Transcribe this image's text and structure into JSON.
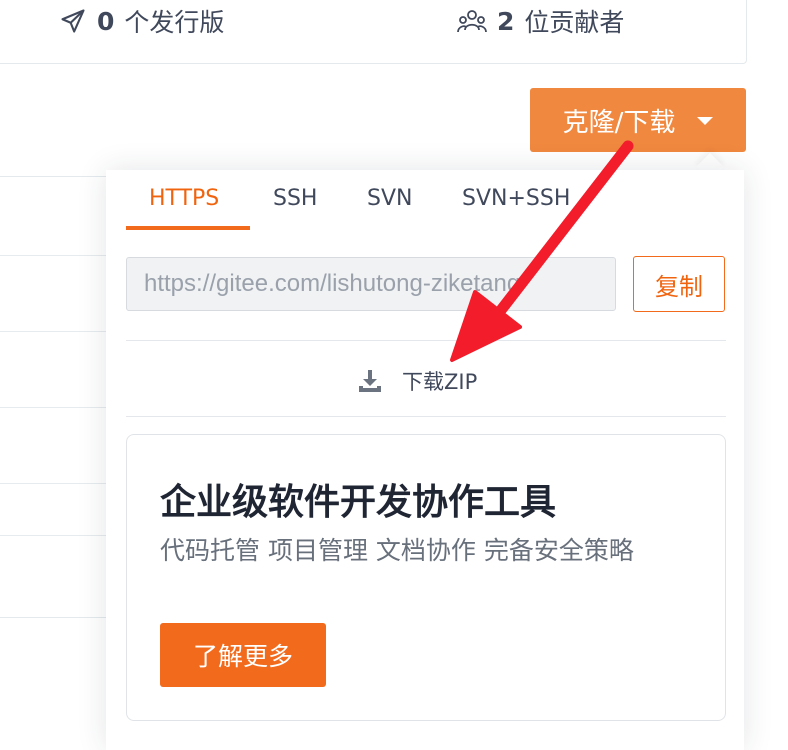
{
  "stats": {
    "releases_count": "0",
    "releases_label": "个发行版",
    "releases_icon": "send-icon",
    "contributors_count": "2",
    "contributors_label": "位贡献者",
    "contributors_icon": "users-icon"
  },
  "clone": {
    "button_label": "克隆/下载",
    "tabs": [
      {
        "label": "HTTPS",
        "active": true
      },
      {
        "label": "SSH",
        "active": false
      },
      {
        "label": "SVN",
        "active": false
      },
      {
        "label": "SVN+SSH",
        "active": false
      }
    ],
    "url_value": "https://gitee.com/lishutong-ziketang",
    "copy_label": "复制",
    "download_zip_label": "下载ZIP",
    "download_icon": "download-icon"
  },
  "promo": {
    "title": "企业级软件开发协作工具",
    "description": "代码托管 项目管理 文档协作 完备安全策略",
    "button_label": "了解更多"
  },
  "colors": {
    "accent": "#f0883f",
    "accent_dark": "#f26b1d",
    "annotation_arrow": "#f21c2b"
  }
}
